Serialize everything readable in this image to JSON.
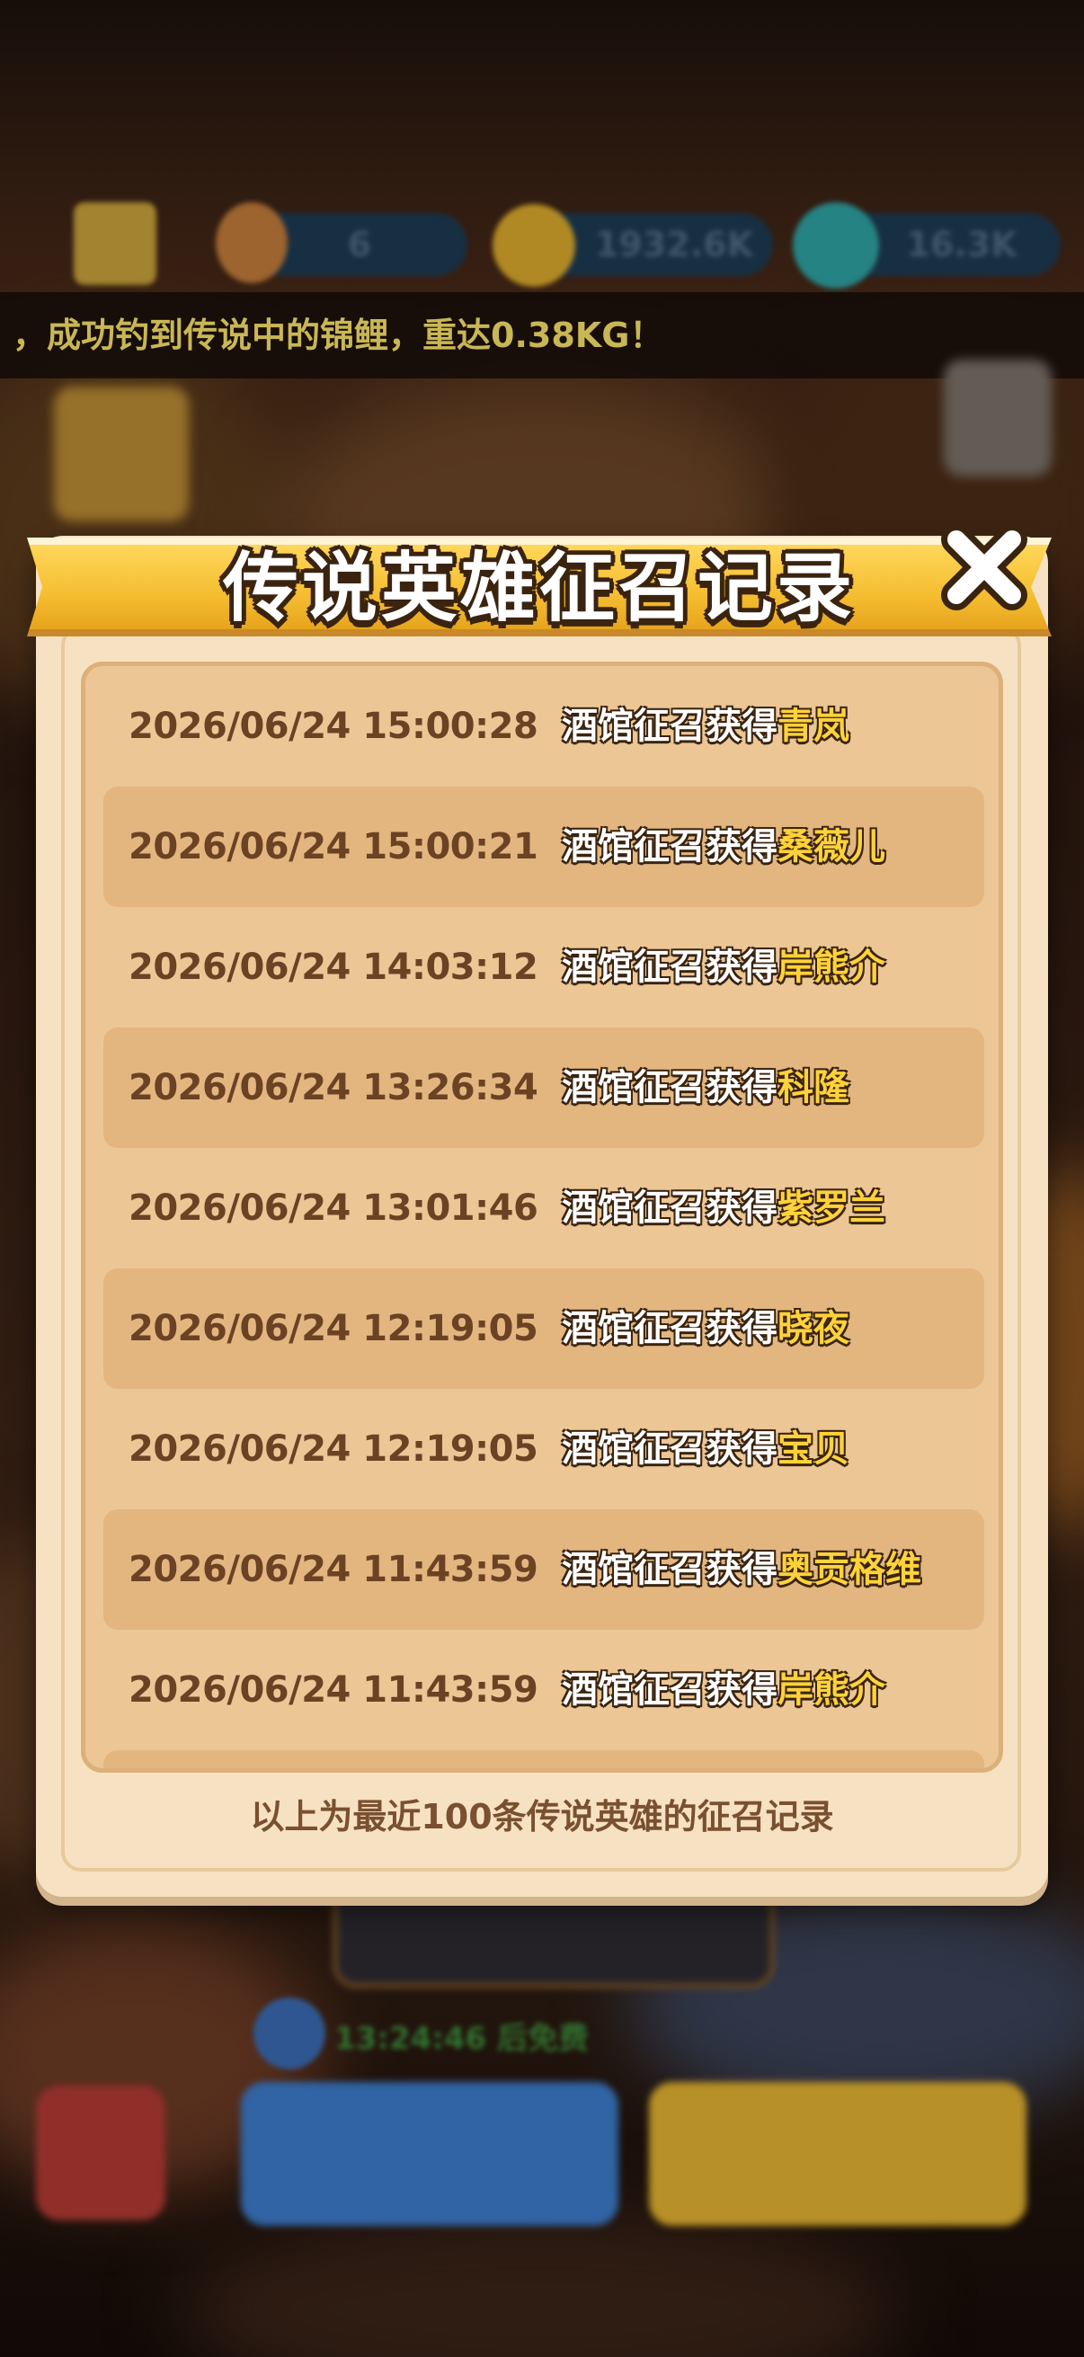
{
  "background": {
    "marquee_text": "，成功钓到传说中的锦鲤，重达0.38KG！",
    "resources": [
      "6",
      "1932.6K",
      "16.3K"
    ],
    "timer_text": "13:24:46 后免费"
  },
  "dialog": {
    "title": "传说英雄征召记录",
    "footer": "以上为最近100条传说英雄的征召记录",
    "records": [
      {
        "time": "2026/06/24 15:00:28",
        "prefix": "酒馆征召获得",
        "hero": "青岚"
      },
      {
        "time": "2026/06/24 15:00:21",
        "prefix": "酒馆征召获得",
        "hero": "桑薇儿"
      },
      {
        "time": "2026/06/24 14:03:12",
        "prefix": "酒馆征召获得",
        "hero": "岸熊介"
      },
      {
        "time": "2026/06/24 13:26:34",
        "prefix": "酒馆征召获得",
        "hero": "科隆"
      },
      {
        "time": "2026/06/24 13:01:46",
        "prefix": "酒馆征召获得",
        "hero": "紫罗兰"
      },
      {
        "time": "2026/06/24 12:19:05",
        "prefix": "酒馆征召获得",
        "hero": "晓夜"
      },
      {
        "time": "2026/06/24 12:19:05",
        "prefix": "酒馆征召获得",
        "hero": "宝贝"
      },
      {
        "time": "2026/06/24 11:43:59",
        "prefix": "酒馆征召获得",
        "hero": "奥贡格维"
      },
      {
        "time": "2026/06/24 11:43:59",
        "prefix": "酒馆征召获得",
        "hero": "岸熊介"
      }
    ]
  },
  "colors": {
    "ribbon": "#f5bd30",
    "panel": "#f6e2c2",
    "list_bg": "#ecc695",
    "row_alt": "#e3b680",
    "hero_name": "#ffd23a",
    "time_text": "#6b4224"
  }
}
